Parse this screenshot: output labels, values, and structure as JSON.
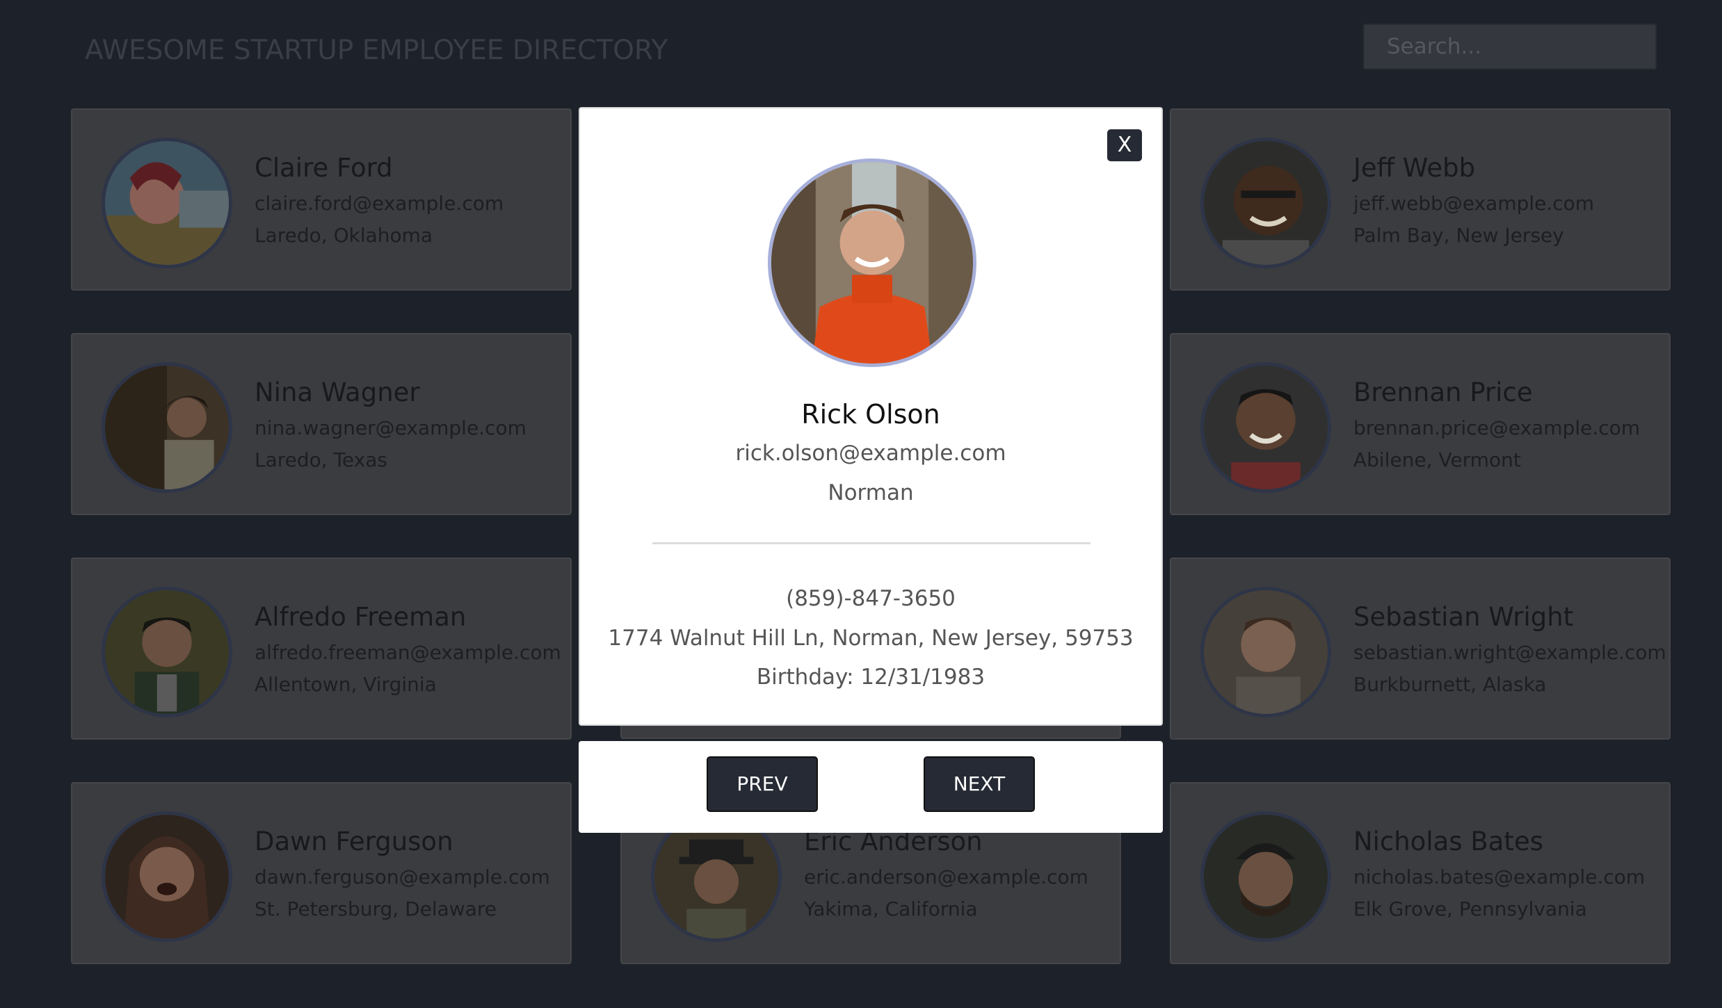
{
  "header": {
    "title": "AWESOME STARTUP EMPLOYEE DIRECTORY"
  },
  "search": {
    "placeholder": "Search..."
  },
  "employees": [
    {
      "name": "Claire Ford",
      "email": "claire.ford@example.com",
      "location": "Laredo, Oklahoma"
    },
    {
      "name": "Jeff Webb",
      "email": "jeff.webb@example.com",
      "location": "Palm Bay, New Jersey"
    },
    {
      "name": "Nina Wagner",
      "email": "nina.wagner@example.com",
      "location": "Laredo, Texas"
    },
    {
      "name": "Brennan Price",
      "email": "brennan.price@example.com",
      "location": "Abilene, Vermont"
    },
    {
      "name": "Alfredo Freeman",
      "email": "alfredo.freeman@example.com",
      "location": "Allentown, Virginia"
    },
    {
      "name": "Sebastian Wright",
      "email": "sebastian.wright@example.com",
      "location": "Burkburnett, Alaska"
    },
    {
      "name": "Dawn Ferguson",
      "email": "dawn.ferguson@example.com",
      "location": "St. Petersburg, Delaware"
    },
    {
      "name": "Eric Anderson",
      "email": "eric.anderson@example.com",
      "location": "Yakima, California"
    },
    {
      "name": "Nicholas Bates",
      "email": "nicholas.bates@example.com",
      "location": "Elk Grove, Pennsylvania"
    }
  ],
  "modal": {
    "close_label": "X",
    "name": "Rick Olson",
    "email": "rick.olson@example.com",
    "city": "Norman",
    "phone": "(859)-847-3650",
    "address": "1774 Walnut Hill Ln, Norman, New Jersey, 59753",
    "birthday": "Birthday: 12/31/1983"
  },
  "nav": {
    "prev_label": "PREV",
    "next_label": "NEXT"
  },
  "colors": {
    "accent": "#262a35",
    "avatar_ring": "#a7b0da",
    "overlay": "#1d2129"
  }
}
